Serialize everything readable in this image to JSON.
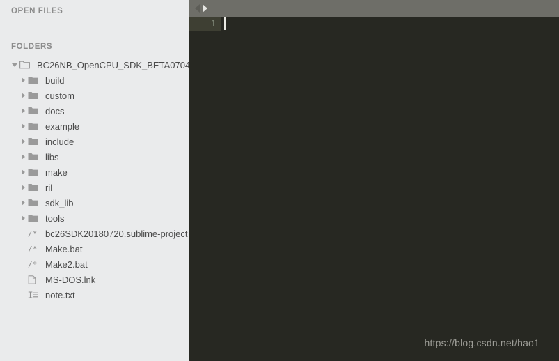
{
  "sidebar": {
    "open_files_header": "OPEN FILES",
    "folders_header": "FOLDERS",
    "root": {
      "label": "BC26NB_OpenCPU_SDK_BETA0704",
      "icon": "folder-open-icon",
      "twisty": "chevron-down-icon",
      "expanded": true
    },
    "folders": [
      {
        "label": "build",
        "icon": "folder-icon",
        "twisty": "chevron-right-icon"
      },
      {
        "label": "custom",
        "icon": "folder-icon",
        "twisty": "chevron-right-icon"
      },
      {
        "label": "docs",
        "icon": "folder-icon",
        "twisty": "chevron-right-icon"
      },
      {
        "label": "example",
        "icon": "folder-icon",
        "twisty": "chevron-right-icon"
      },
      {
        "label": "include",
        "icon": "folder-icon",
        "twisty": "chevron-right-icon"
      },
      {
        "label": "libs",
        "icon": "folder-icon",
        "twisty": "chevron-right-icon"
      },
      {
        "label": "make",
        "icon": "folder-icon",
        "twisty": "chevron-right-icon"
      },
      {
        "label": "ril",
        "icon": "folder-icon",
        "twisty": "chevron-right-icon"
      },
      {
        "label": "sdk_lib",
        "icon": "folder-icon",
        "twisty": "chevron-right-icon"
      },
      {
        "label": "tools",
        "icon": "folder-icon",
        "twisty": "chevron-right-icon"
      }
    ],
    "files": [
      {
        "label": "bc26SDK20180720.sublime-project",
        "icon": "source-file-icon"
      },
      {
        "label": "Make.bat",
        "icon": "source-file-icon"
      },
      {
        "label": "Make2.bat",
        "icon": "source-file-icon"
      },
      {
        "label": "MS-DOS.lnk",
        "icon": "page-file-icon"
      },
      {
        "label": "note.txt",
        "icon": "text-file-icon"
      }
    ]
  },
  "editor": {
    "tabbar": {
      "prev_icon": "arrow-left-icon",
      "next_icon": "arrow-right-icon"
    },
    "gutter": {
      "line_numbers": [
        "1"
      ]
    },
    "content": "",
    "watermark": "https://blog.csdn.net/hao1__"
  },
  "colors": {
    "sidebar_bg": "#eaebec",
    "editor_bg": "#272822",
    "gutter_bg": "#3e3f33",
    "tabbar_bg": "#6e6e68",
    "header_text": "#8b8b8b",
    "item_text": "#4b4b4b",
    "icon_gray": "#9a9a9a",
    "line_number": "#7d8475",
    "watermark_text": "#9d9d97"
  }
}
